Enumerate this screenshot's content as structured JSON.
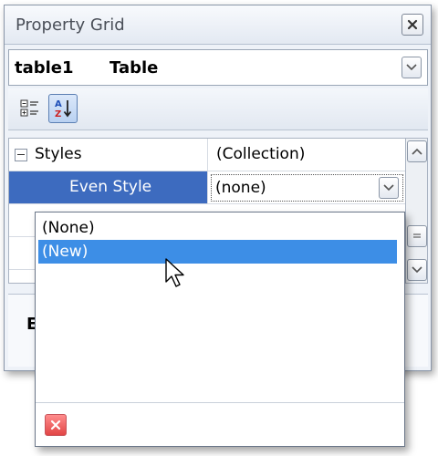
{
  "window": {
    "title": "Property Grid"
  },
  "object_selector": {
    "name": "table1",
    "type": "Table"
  },
  "grid": {
    "rows": [
      {
        "name": "Styles",
        "value": "(Collection)"
      },
      {
        "name": "Even Style",
        "value": "(none)"
      }
    ]
  },
  "dropdown": {
    "items": [
      "(None)",
      "(New)"
    ]
  },
  "description": {
    "text": "E"
  },
  "colors": {
    "selection": "#3d6bbf",
    "highlight": "#3d8ee6",
    "delete_button": "#e24545"
  }
}
